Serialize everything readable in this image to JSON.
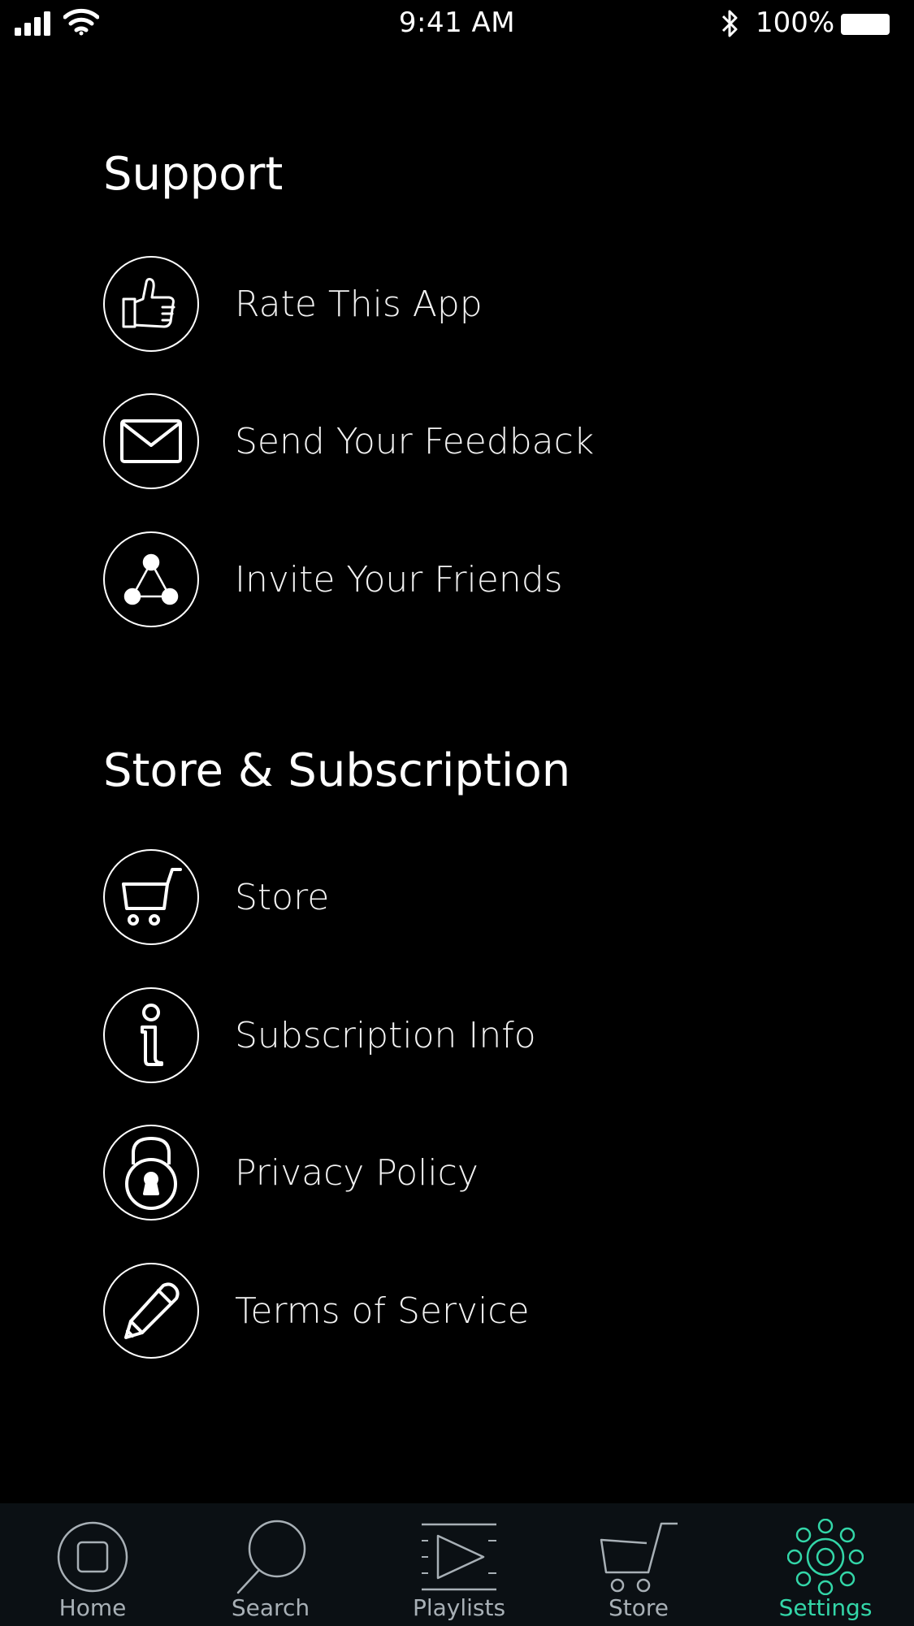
{
  "status_bar": {
    "time": "9:41 AM",
    "battery_percent": "100%",
    "icons": [
      "signal-icon",
      "wifi-icon",
      "bluetooth-icon",
      "battery-icon"
    ]
  },
  "sections": {
    "support": {
      "title": "Support",
      "items": [
        {
          "label": "Rate This App",
          "icon": "thumbs-up-icon"
        },
        {
          "label": "Send Your Feedback",
          "icon": "mail-icon"
        },
        {
          "label": "Invite Your Friends",
          "icon": "share-icon"
        }
      ]
    },
    "store": {
      "title": "Store & Subscription",
      "items": [
        {
          "label": "Store",
          "icon": "cart-icon"
        },
        {
          "label": "Subscription Info",
          "icon": "info-icon"
        },
        {
          "label": "Privacy Policy",
          "icon": "lock-icon"
        },
        {
          "label": "Terms of Service",
          "icon": "pencil-icon"
        }
      ]
    }
  },
  "tab_bar": {
    "active_color": "#33d6a8",
    "inactive_color": "#a8b0b6",
    "active_tab": "Settings",
    "tabs": [
      {
        "label": "Home",
        "icon": "home-icon"
      },
      {
        "label": "Search",
        "icon": "search-icon"
      },
      {
        "label": "Playlists",
        "icon": "playlists-icon"
      },
      {
        "label": "Store",
        "icon": "cart-icon"
      },
      {
        "label": "Settings",
        "icon": "gear-icon"
      }
    ]
  }
}
